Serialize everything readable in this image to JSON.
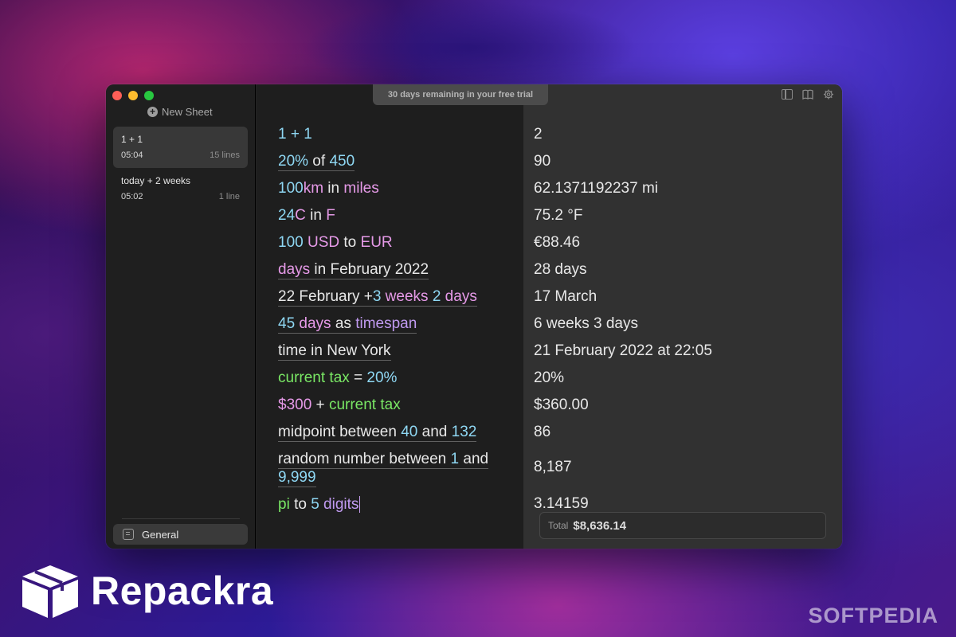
{
  "window": {
    "new_sheet_label": "New Sheet",
    "trial_banner": "30 days remaining in your free trial"
  },
  "sidebar": {
    "sheets": [
      {
        "title": "1 + 1",
        "time": "05:04",
        "lines": "15 lines"
      },
      {
        "title": "today + 2 weeks",
        "time": "05:02",
        "lines": "1 line"
      }
    ],
    "general_label": "General"
  },
  "editor": {
    "l1": {
      "a": "1 + 1"
    },
    "l2": {
      "a": "20%",
      "b": " of ",
      "c": "450"
    },
    "l3": {
      "a": "100",
      "b": "km",
      "c": " in ",
      "d": "miles"
    },
    "l4": {
      "a": "24",
      "b": "C",
      "c": " in ",
      "d": "F"
    },
    "l5": {
      "a": "100",
      "b": " USD",
      "c": " to ",
      "d": "EUR"
    },
    "l6": {
      "a": "days",
      "b": " in February 2022"
    },
    "l7": {
      "a": "22 February +",
      "b": "3",
      "c": " weeks",
      "d": " 2",
      "e": " days"
    },
    "l8": {
      "a": "45",
      "b": " days",
      "c": " as ",
      "d": "timespan"
    },
    "l9": {
      "a": "time in New York"
    },
    "l10": {
      "a": "current tax",
      "b": " = ",
      "c": "20%"
    },
    "l11": {
      "a": "$300",
      "b": " + ",
      "c": "current tax"
    },
    "l12": {
      "a": "midpoint between ",
      "b": "40",
      "c": " and ",
      "d": "132"
    },
    "l13": {
      "a": "random number between ",
      "b": "1",
      "c": " and",
      "d": "9,999"
    },
    "l14": {
      "a": "pi",
      "b": " to ",
      "c": "5",
      "d": " digits"
    }
  },
  "results": [
    "2",
    "90",
    "62.1371192237 mi",
    "75.2 °F",
    "€88.46",
    "28 days",
    "17 March",
    "6 weeks 3 days",
    "21 February 2022 at 22:05",
    "20%",
    "$360.00",
    "86",
    "8,187",
    "3.14159"
  ],
  "total": {
    "label": "Total",
    "value": "$8,636.14"
  },
  "branding": {
    "name": "Repackra",
    "watermark": "SOFTPEDIA"
  },
  "colors": {
    "number": "#8fd8f4",
    "unit": "#e69ae8",
    "keyword": "#7ae865",
    "function": "#c09af0"
  }
}
